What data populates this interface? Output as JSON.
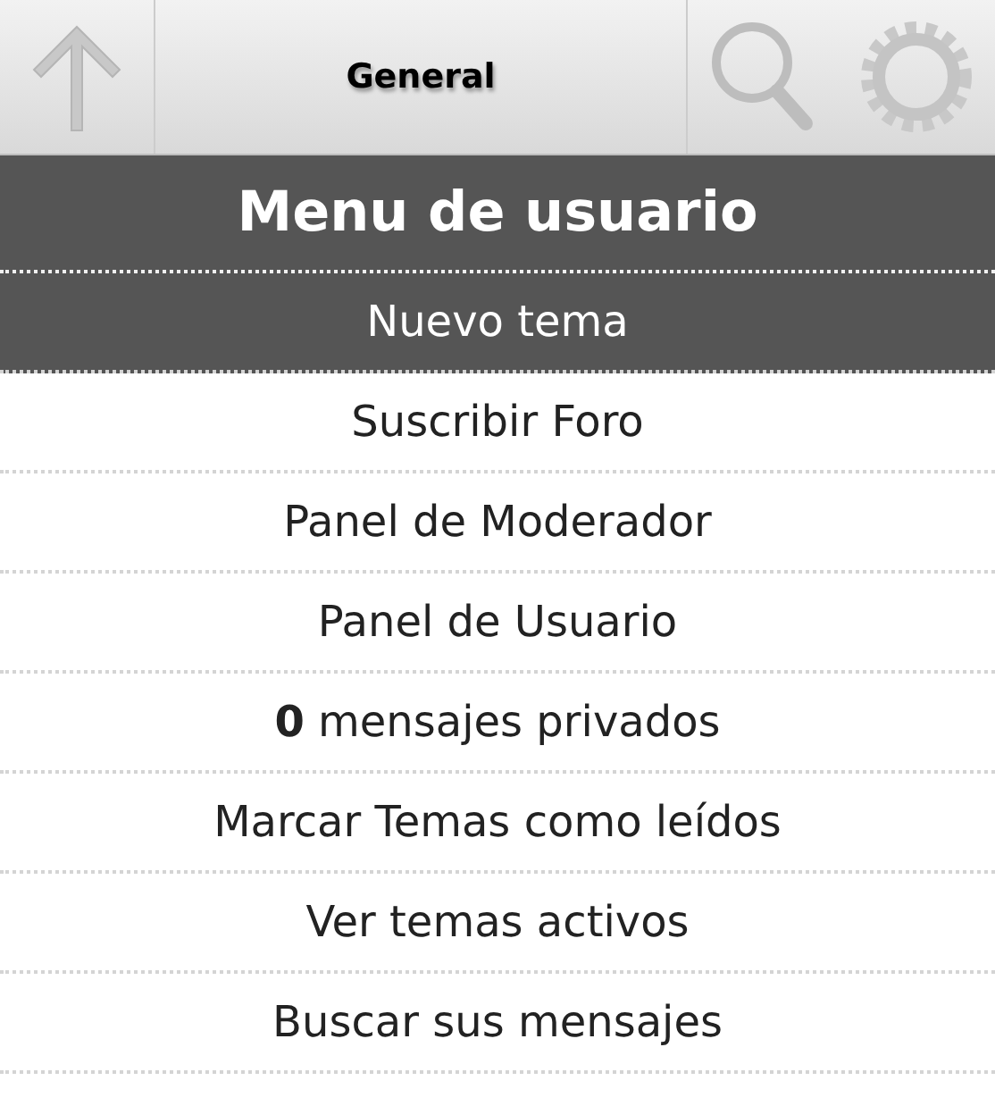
{
  "toolbar": {
    "title": "General"
  },
  "menu": {
    "title": "Menu de usuario",
    "items": [
      {
        "label": "Nuevo tema",
        "selected": true
      },
      {
        "label": "Suscribir Foro",
        "selected": false
      },
      {
        "label": "Panel de Moderador",
        "selected": false
      },
      {
        "label": "Panel de Usuario",
        "selected": false
      },
      {
        "label": "**0** mensajes privados",
        "selected": false
      },
      {
        "label": "Marcar Temas como leídos",
        "selected": false
      },
      {
        "label": "Ver temas activos",
        "selected": false
      },
      {
        "label": "Buscar sus mensajes",
        "selected": false
      }
    ]
  }
}
